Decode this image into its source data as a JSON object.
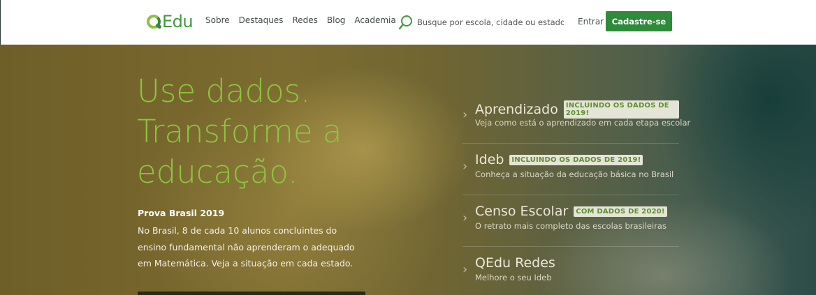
{
  "header": {
    "logo_text": "Edu",
    "nav": [
      "Sobre",
      "Destaques",
      "Redes",
      "Blog",
      "Academia"
    ],
    "search_placeholder": "Busque por escola, cidade ou estado...",
    "login_label": "Entrar",
    "signup_label": "Cadastre-se",
    "colors": {
      "brand_green": "#2e8b3a",
      "accent_lime": "#8cc63f"
    }
  },
  "hero": {
    "title_lines": [
      "Use dados.",
      "Transforme a",
      "educação."
    ],
    "highlight_title": "Prova Brasil 2019",
    "highlight_text": "No Brasil, 8 de cada 10 alunos concluintes do ensino fundamental não aprenderam o adequado em Matemática. Veja a situação em cada estado."
  },
  "features": [
    {
      "title": "Aprendizado",
      "badge": "INCLUINDO OS DADOS DE 2019!",
      "description": "Veja como está o aprendizado em cada etapa escolar"
    },
    {
      "title": "Ideb",
      "badge": "INCLUINDO OS DADOS DE 2019!",
      "description": "Conheça a situação da educação básica no Brasil"
    },
    {
      "title": "Censo Escolar",
      "badge": "COM DADOS DE 2020!",
      "description": "O retrato mais completo das escolas brasileiras"
    },
    {
      "title": "QEdu Redes",
      "badge": "",
      "description": "Melhore o seu Ideb"
    }
  ],
  "icons": {
    "logo": "qedu-logo-icon",
    "search": "search-icon",
    "chevron": "chevron-right-icon"
  }
}
